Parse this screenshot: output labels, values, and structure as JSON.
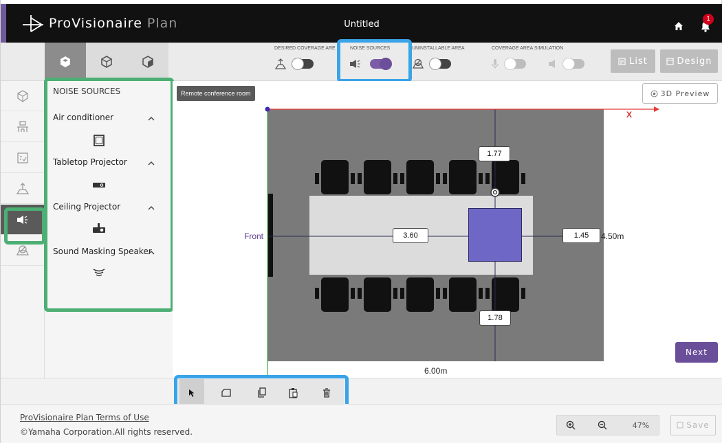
{
  "app": {
    "brand_pre": "Pro",
    "brand_v": "V",
    "brand_mid": "isionaire",
    "brand_post": " Plan",
    "document_title": "Untitled",
    "notification_count": "1"
  },
  "toggles": {
    "desired_coverage": {
      "label": "DESIRED COVERAGE ARE",
      "state": "off"
    },
    "noise_sources": {
      "label": "NOISE SOURCES",
      "state": "on"
    },
    "uninstallable": {
      "label": "UNINSTALLABLE AREA",
      "state": "off"
    },
    "coverage_sim": {
      "label": "COVERAGE AREA SIMULATION",
      "state": "disabled"
    }
  },
  "buttons": {
    "list": "List",
    "design": "Design",
    "preview_3d": "3D Preview",
    "next": "Next",
    "save": "Save"
  },
  "panel": {
    "title": "NOISE SOURCES",
    "categories": [
      {
        "label": "Air conditioner",
        "icon": "air-conditioner-icon"
      },
      {
        "label": "Tabletop Projector",
        "icon": "tabletop-projector-icon"
      },
      {
        "label": "Ceiling Projector",
        "icon": "ceiling-projector-icon"
      },
      {
        "label": "Sound Masking Speaker",
        "icon": "sound-masking-speaker-icon"
      }
    ]
  },
  "canvas": {
    "room_name": "Remote conference room",
    "axis_x": "X",
    "front_label": "Front",
    "dim_top": "1.77",
    "dim_left": "3.60",
    "dim_right": "1.45",
    "dim_bottom": "1.78",
    "room_depth": "4.50m",
    "room_width": "6.00m"
  },
  "footer": {
    "terms_link": "ProVisionaire Plan Terms of Use",
    "copyright": "©Yamaha Corporation.All rights reserved.",
    "zoom": "47%"
  },
  "colors": {
    "accent": "#6a4e99",
    "highlight_blue": "#3aa3e8",
    "highlight_green": "#4caf73",
    "mic_area": "#6f67c6",
    "axis": "#e53935"
  }
}
